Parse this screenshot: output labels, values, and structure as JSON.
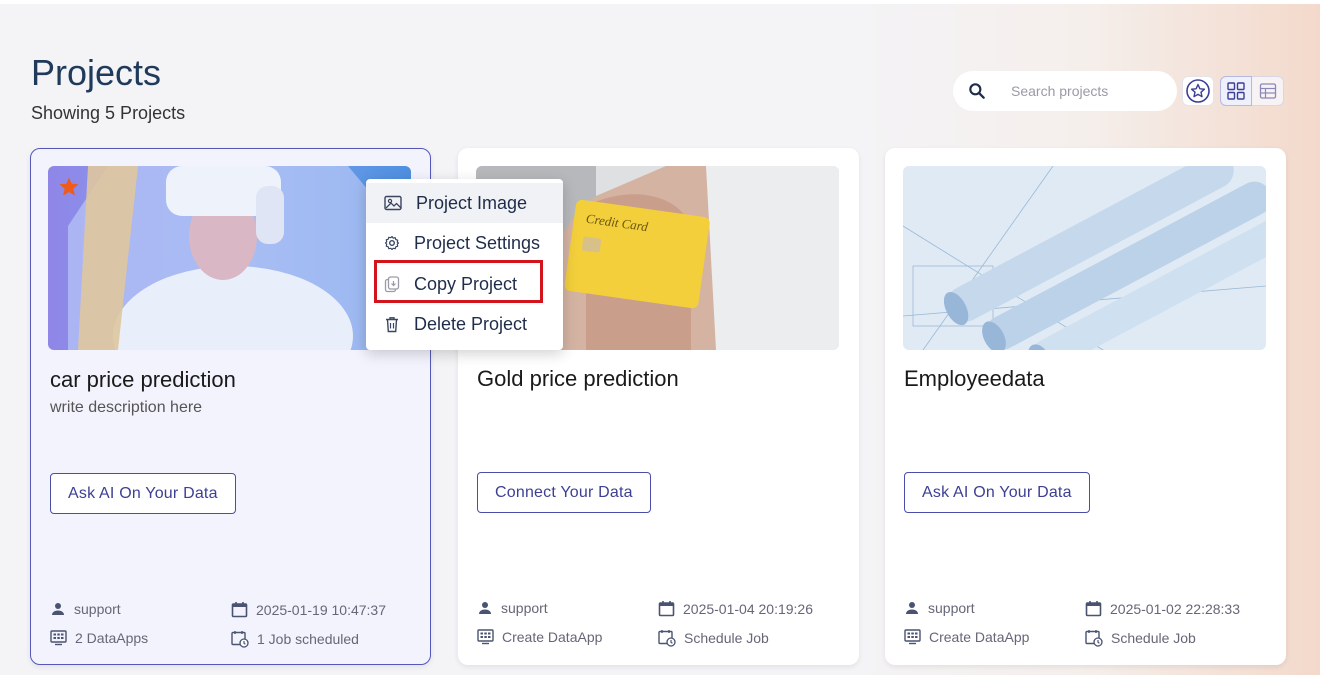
{
  "header": {
    "title": "Projects",
    "subtitle": "Showing 5 Projects"
  },
  "search": {
    "placeholder": "Search projects",
    "icon": "search-icon"
  },
  "toolbar": {
    "favorites_icon": "star-circle-icon",
    "grid_view_icon": "grid-view-icon",
    "table_view_icon": "table-view-icon"
  },
  "context_menu": {
    "items": [
      {
        "label": "Project Image",
        "icon": "image-icon"
      },
      {
        "label": "Project Settings",
        "icon": "gear-icon"
      },
      {
        "label": "Copy Project",
        "icon": "copy-icon"
      },
      {
        "label": "Delete Project",
        "icon": "trash-icon"
      }
    ],
    "highlighted": "Copy Project"
  },
  "projects": [
    {
      "name": "car price prediction",
      "description": "write description here",
      "action": "Ask AI On Your Data",
      "user": "support",
      "date": "2025-01-19 10:47:37",
      "dataapps": "2 DataApps",
      "jobs": "1 Job scheduled",
      "favorite": true
    },
    {
      "name": "Gold price prediction",
      "description": "",
      "action": "Connect Your Data",
      "user": "support",
      "date": "2025-01-04 20:19:26",
      "dataapps": "Create DataApp",
      "jobs": "Schedule Job",
      "favorite": false,
      "image_text": "Credit Card"
    },
    {
      "name": "Employeedata",
      "description": "",
      "action": "Ask AI On Your Data",
      "user": "support",
      "date": "2025-01-02 22:28:33",
      "dataapps": "Create DataApp",
      "jobs": "Schedule Job",
      "favorite": false
    }
  ],
  "colors": {
    "accent": "#3d3f95",
    "title": "#1f3a5a",
    "favorite_star": "#f05a1a",
    "highlight_box": "#d4141c"
  }
}
